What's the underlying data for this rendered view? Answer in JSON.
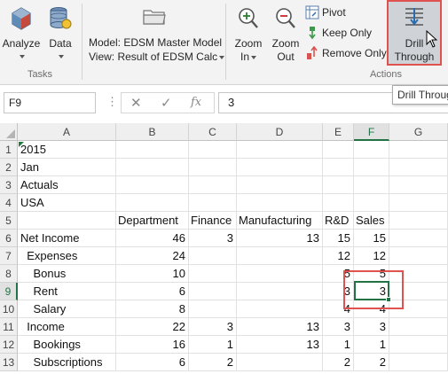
{
  "ribbon": {
    "tasks": {
      "group_label": "Tasks",
      "analyze_label": "Analyze",
      "data_label": "Data"
    },
    "model_line": "Model: EDSM Master Model",
    "view_line": "View: Result of EDSM Calc",
    "actions": {
      "group_label": "Actions",
      "zoom_in_line1": "Zoom",
      "zoom_in_line2": "In",
      "zoom_out_line1": "Zoom",
      "zoom_out_line2": "Out",
      "pivot_label": "Pivot",
      "keep_only_label": "Keep Only",
      "remove_only_label": "Remove Only",
      "drill_line1": "Drill",
      "drill_line2": "Through"
    },
    "tooltip": "Drill Through"
  },
  "formula_bar": {
    "name_box": "F9",
    "fx_symbol": "fx",
    "value": "3"
  },
  "columns": [
    "A",
    "B",
    "C",
    "D",
    "E",
    "F",
    "G"
  ],
  "rows": [
    {
      "n": "1",
      "A": "2015"
    },
    {
      "n": "2",
      "A": "Jan"
    },
    {
      "n": "3",
      "A": "Actuals"
    },
    {
      "n": "4",
      "A": "USA"
    },
    {
      "n": "5",
      "B": "Department",
      "C": "Finance",
      "D": "Manufacturing",
      "E": "R&D",
      "F": "Sales"
    },
    {
      "n": "6",
      "A": "Net Income",
      "B": "46",
      "C": "3",
      "D": "13",
      "E": "15",
      "F": "15"
    },
    {
      "n": "7",
      "A": "  Expenses",
      "B": "24",
      "E": "12",
      "F": "12"
    },
    {
      "n": "8",
      "A": "    Bonus",
      "B": "10",
      "E": "5",
      "F": "5"
    },
    {
      "n": "9",
      "A": "    Rent",
      "B": "6",
      "E": "3",
      "F": "3"
    },
    {
      "n": "10",
      "A": "    Salary",
      "B": "8",
      "E": "4",
      "F": "4"
    },
    {
      "n": "11",
      "A": "  Income",
      "B": "22",
      "C": "3",
      "D": "13",
      "E": "3",
      "F": "3"
    },
    {
      "n": "12",
      "A": "    Bookings",
      "B": "16",
      "C": "1",
      "D": "13",
      "E": "1",
      "F": "1"
    },
    {
      "n": "13",
      "A": "    Subscriptions",
      "B": "6",
      "C": "2",
      "E": "2",
      "F": "2"
    }
  ],
  "colors": {
    "excel_green": "#217346",
    "highlight_red": "#e0524f"
  }
}
